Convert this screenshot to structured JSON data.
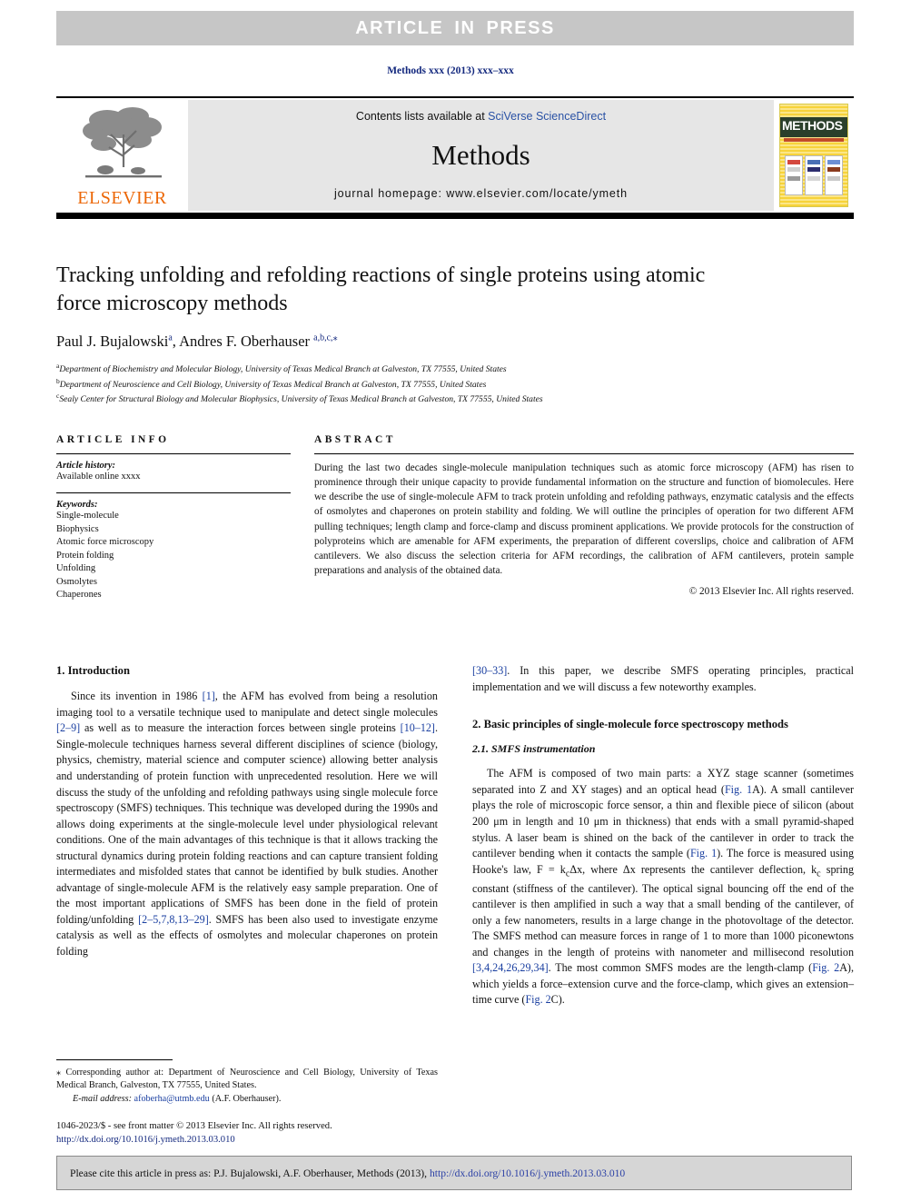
{
  "banner": {
    "article_in_press": "ARTICLE IN PRESS"
  },
  "journal_ref": "Methods xxx (2013) xxx–xxx",
  "masthead": {
    "publisher": "ELSEVIER",
    "contents_prefix": "Contents lists available at ",
    "contents_link": "SciVerse ScienceDirect",
    "journal_title": "Methods",
    "homepage": "journal homepage: www.elsevier.com/locate/ymeth",
    "cover_title": "METHODS"
  },
  "article": {
    "title": "Tracking unfolding and refolding reactions of single proteins using atomic force microscopy methods",
    "authors": "Paul J. Bujalowski, Andres F. Oberhauser",
    "author_marks": {
      "first": "a",
      "second": "a,b,c,"
    },
    "affiliations": [
      {
        "mark": "a",
        "text": "Department of Biochemistry and Molecular Biology, University of Texas Medical Branch at Galveston, TX 77555, United States"
      },
      {
        "mark": "b",
        "text": "Department of Neuroscience and Cell Biology, University of Texas Medical Branch at Galveston, TX 77555, United States"
      },
      {
        "mark": "c",
        "text": "Sealy Center for Structural Biology and Molecular Biophysics, University of Texas Medical Branch at Galveston, TX 77555, United States"
      }
    ]
  },
  "article_info": {
    "heading": "ARTICLE INFO",
    "history_label": "Article history:",
    "history_value": "Available online xxxx",
    "keywords_label": "Keywords:",
    "keywords": [
      "Single-molecule",
      "Biophysics",
      "Atomic force microscopy",
      "Protein folding",
      "Unfolding",
      "Osmolytes",
      "Chaperones"
    ]
  },
  "abstract": {
    "heading": "ABSTRACT",
    "text": "During the last two decades single-molecule manipulation techniques such as atomic force microscopy (AFM) has risen to prominence through their unique capacity to provide fundamental information on the structure and function of biomolecules. Here we describe the use of single-molecule AFM to track protein unfolding and refolding pathways, enzymatic catalysis and the effects of osmolytes and chaperones on protein stability and folding. We will outline the principles of operation for two different AFM pulling techniques; length clamp and force-clamp and discuss prominent applications. We provide protocols for the construction of polyproteins which are amenable for AFM experiments, the preparation of different coverslips, choice and calibration of AFM cantilevers. We also discuss the selection criteria for AFM recordings, the calibration of AFM cantilevers, protein sample preparations and analysis of the obtained data.",
    "copyright": "© 2013 Elsevier Inc. All rights reserved."
  },
  "body": {
    "left": {
      "section1_heading": "1. Introduction",
      "section1_p1_part1": "Since its invention in 1986 ",
      "section1_p1_ref1": "[1]",
      "section1_p1_part2": ", the AFM has evolved from being a resolution imaging tool to a versatile technique used to manipulate and detect single molecules ",
      "section1_p1_ref2": "[2–9]",
      "section1_p1_part3": " as well as to measure the interaction forces between single proteins ",
      "section1_p1_ref3": "[10–12]",
      "section1_p1_part4": ". Single-molecule techniques harness several different disciplines of science (biology, physics, chemistry, material science and computer science) allowing better analysis and understanding of protein function with unprecedented resolution. Here we will discuss the study of the unfolding and refolding pathways using single molecule force spectroscopy (SMFS) techniques. This technique was developed during the 1990s and allows doing experiments at the single-molecule level under physiological relevant conditions. One of the main advantages of this technique is that it allows tracking the structural dynamics during protein folding reactions and can capture transient folding intermediates and misfolded states that cannot be identified by bulk studies. Another advantage of single-molecule AFM is the relatively easy sample preparation. One of the most important applications of SMFS has been done in the field of protein folding/unfolding ",
      "section1_p1_ref4": "[2–5,7,8,13–29]",
      "section1_p1_part5": ". SMFS has been also used to investigate enzyme catalysis as well as the effects of osmolytes and molecular chaperones on protein folding"
    },
    "right": {
      "cont_ref": "[30–33]",
      "cont_text": ". In this paper, we describe SMFS operating principles, practical implementation and we will discuss a few noteworthy examples.",
      "section2_heading": "2. Basic principles of single-molecule force spectroscopy methods",
      "section21_heading": "2.1. SMFS instrumentation",
      "p1_a": "The AFM is composed of two main parts: a XYZ stage scanner (sometimes separated into Z and XY stages) and an optical head (",
      "p1_fig1a": "Fig. 1",
      "p1_b": "A). A small cantilever plays the role of microscopic force sensor, a thin and flexible piece of silicon (about 200 μm in length and 10 μm in thickness) that ends with a small pyramid-shaped stylus. A laser beam is shined on the back of the cantilever in order to track the cantilever bending when it contacts the sample (",
      "p1_fig1b": "Fig. 1",
      "p1_c": "). The force is measured using Hooke's law, F = k",
      "p1_sub1": "c",
      "p1_d": "Δx, where Δx represents the cantilever deflection, k",
      "p1_sub2": "c",
      "p1_e": " spring constant (stiffness of the cantilever). The optical signal bouncing off the end of the cantilever is then amplified in such a way that a small bending of the cantilever, of only a few nanometers, results in a large change in the photovoltage of the detector. The SMFS method can measure forces in range of 1 to more than 1000 piconewtons and changes in the length of proteins with nanometer and millisecond resolution ",
      "p1_ref2": "[3,4,24,26,29,34]",
      "p1_f": ". The most common SMFS modes are the length-clamp (",
      "p1_fig2a": "Fig. 2",
      "p1_g": "A), which yields a force–extension curve and the force-clamp, which gives an extension–time curve (",
      "p1_fig2c": "Fig. 2",
      "p1_h": "C)."
    }
  },
  "footer": {
    "corresponding_mark": "⁎",
    "corresponding_text": " Corresponding author at: Department of Neuroscience and Cell Biology, University of Texas Medical Branch, Galveston, TX 77555, United States.",
    "email_label": "E-mail address:",
    "email": "afoberha@utmb.edu",
    "email_suffix": " (A.F. Oberhauser).",
    "issn_line": "1046-2023/$ - see front matter © 2013 Elsevier Inc. All rights reserved.",
    "doi_line": "http://dx.doi.org/10.1016/j.ymeth.2013.03.010"
  },
  "cite_banner": {
    "prefix": "Please cite this article in press as: P.J. Bujalowski, A.F. Oberhauser, Methods (2013), ",
    "doi": "http://dx.doi.org/10.1016/j.ymeth.2013.03.010"
  },
  "colors": {
    "banner_gray": "#c6c6c6",
    "link_blue": "#2a52a5",
    "ref_blue": "#1a3fa0",
    "elsevier_orange": "#ec6707",
    "masthead_gray": "#e6e6e6",
    "cite_gray": "#d6d6d6"
  }
}
